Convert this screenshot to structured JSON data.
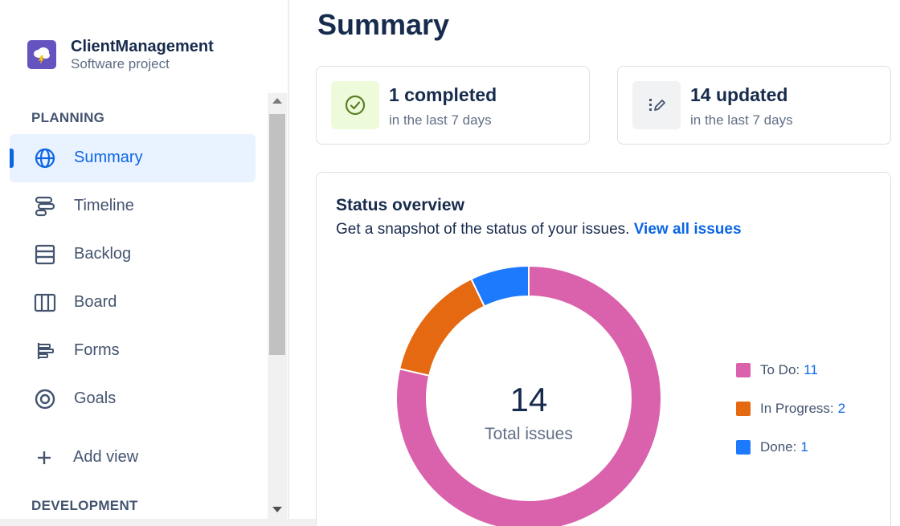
{
  "project": {
    "name": "ClientManagement",
    "type": "Software project"
  },
  "sidebar": {
    "planning_heading": "PLANNING",
    "development_heading": "DEVELOPMENT",
    "items": [
      {
        "label": "Summary",
        "icon": "globe-icon",
        "active": true
      },
      {
        "label": "Timeline",
        "icon": "timeline-icon"
      },
      {
        "label": "Backlog",
        "icon": "backlog-icon"
      },
      {
        "label": "Board",
        "icon": "board-icon"
      },
      {
        "label": "Forms",
        "icon": "forms-icon"
      },
      {
        "label": "Goals",
        "icon": "goals-icon"
      }
    ],
    "add_view": "Add view"
  },
  "page": {
    "title": "Summary"
  },
  "stats": {
    "completed": {
      "title": "1 completed",
      "sub": "in the last 7 days",
      "icon": "check-circle-icon"
    },
    "updated": {
      "title": "14 updated",
      "sub": "in the last 7 days",
      "icon": "edit-icon"
    }
  },
  "status_overview": {
    "title": "Status overview",
    "description": "Get a snapshot of the status of your issues.",
    "link": "View all issues",
    "total": "14",
    "total_label": "Total issues"
  },
  "chart_data": {
    "type": "pie",
    "categories": [
      "To Do",
      "In Progress",
      "Done"
    ],
    "values": [
      11,
      2,
      1
    ],
    "colors": [
      "#da62ac",
      "#e56910",
      "#1d7afc"
    ],
    "legend_position": "right"
  }
}
